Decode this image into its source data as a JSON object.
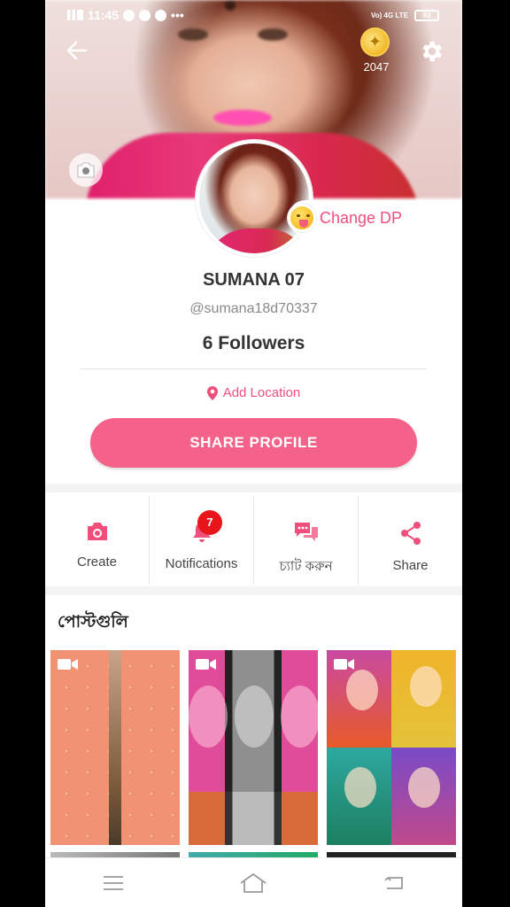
{
  "status_bar": {
    "time": "11:45",
    "extra": "•••",
    "network": "Vo) 4G LTE",
    "battery": "93"
  },
  "header": {
    "coins": "2047"
  },
  "profile": {
    "change_dp_label": "Change DP",
    "name": "SUMANA 07",
    "handle": "@sumana18d70337",
    "followers": "6 Followers",
    "location_label": "Add Location",
    "share_button_label": "SHARE PROFILE"
  },
  "actions": [
    {
      "label": "Create",
      "icon": "camera-icon"
    },
    {
      "label": "Notifications",
      "icon": "bell-icon",
      "badge": "7"
    },
    {
      "label": "চ্যাট করুন",
      "icon": "chat-icon"
    },
    {
      "label": "Share",
      "icon": "share-icon"
    }
  ],
  "posts": {
    "title": "পোস্টগুলি",
    "items": [
      {
        "type": "video",
        "icon": "video-icon"
      },
      {
        "type": "video",
        "icon": "video-icon"
      },
      {
        "type": "video",
        "icon": "video-icon"
      }
    ]
  },
  "nav": [
    {
      "icon": "menu-icon"
    },
    {
      "icon": "home-icon"
    },
    {
      "icon": "back-nav-icon"
    }
  ],
  "colors": {
    "accent": "#f4628a",
    "accent_text": "#f04f7c",
    "badge": "#e8161b"
  }
}
